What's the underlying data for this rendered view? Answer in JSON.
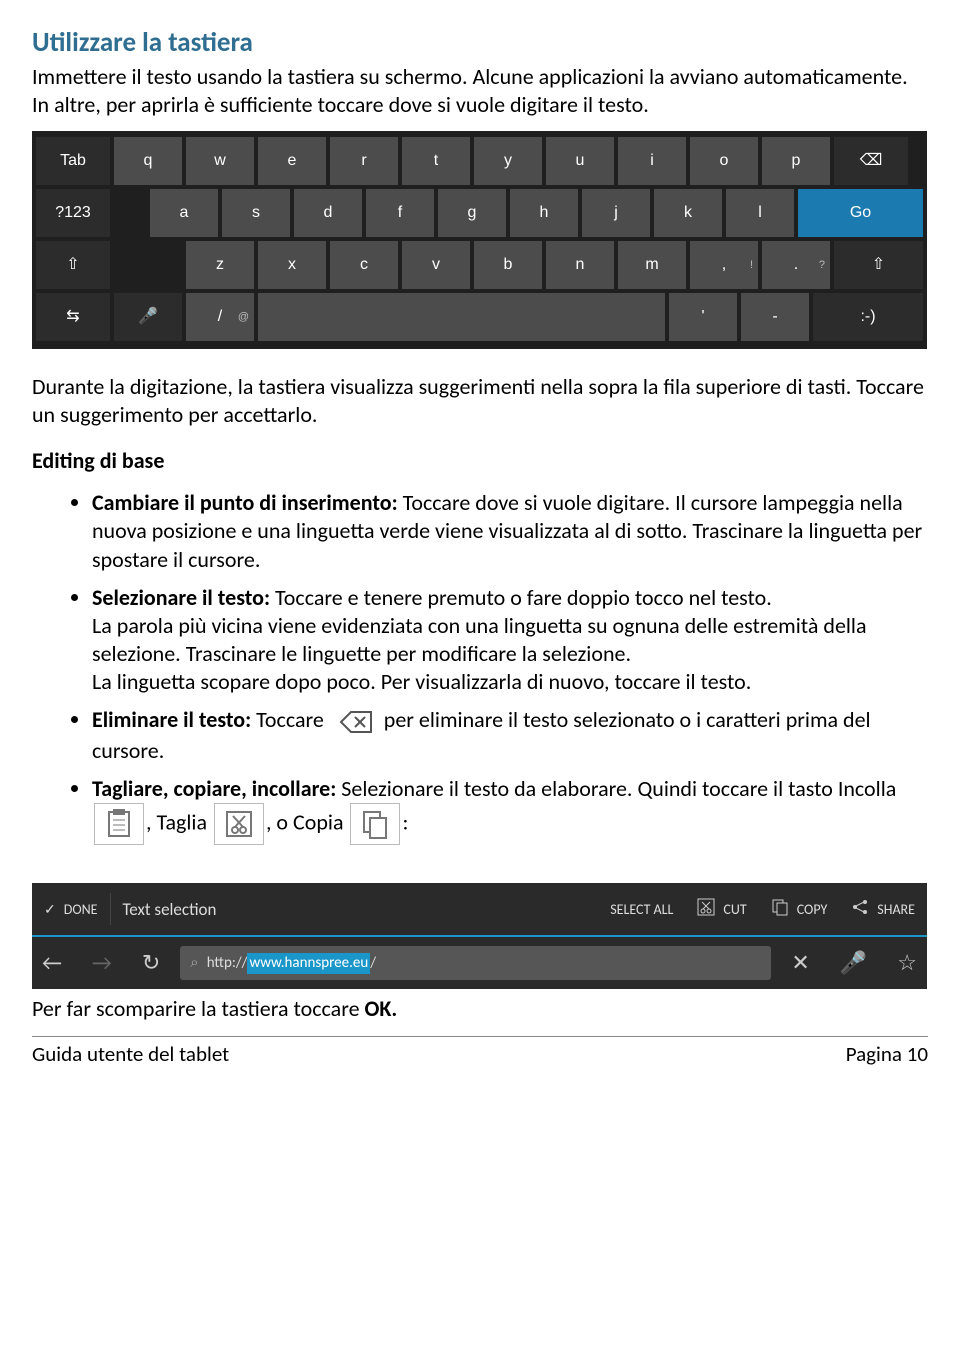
{
  "title": "Utilizzare la tastiera",
  "intro": "Immettere il testo usando la tastiera su schermo. Alcune applicazioni la avviano automaticamente. In altre, per aprirla è sufficiente toccare dove si vuole digitare il testo.",
  "keyboard": {
    "row1": [
      "Tab",
      "q",
      "w",
      "e",
      "r",
      "t",
      "y",
      "u",
      "i",
      "o",
      "p",
      "⌫"
    ],
    "row2": [
      "?123",
      "a",
      "s",
      "d",
      "f",
      "g",
      "h",
      "j",
      "k",
      "l",
      "Go"
    ],
    "row3": [
      "⇧",
      "z",
      "x",
      "c",
      "v",
      "b",
      "n",
      "m",
      ",",
      ".",
      "⇧"
    ],
    "row4": [
      "⇆",
      "🎤",
      "/",
      "",
      " ' ",
      "-",
      ":-)"
    ]
  },
  "para_after_kbd": "Durante la digitazione, la tastiera visualizza suggerimenti nella sopra la fila superiore di tasti. Toccare un suggerimento per accettarlo.",
  "editing_heading": "Editing di base",
  "b1_lead": "Cambiare il punto di inserimento:",
  "b1_rest": " Toccare dove si vuole digitare. Il cursore lampeggia nella nuova posizione e una linguetta verde viene visualizzata al di sotto. Trascinare la linguetta per spostare il cursore.",
  "b2_lead": "Selezionare il testo:",
  "b2_rest": " Toccare e tenere premuto o fare doppio tocco nel testo.",
  "b2_p2": "La parola più vicina viene evidenziata con una linguetta su ognuna delle estremità della selezione. Trascinare le linguette per modificare la selezione.",
  "b2_p3": "La linguetta scopare dopo poco. Per visualizzarla di nuovo, toccare il testo.",
  "b3_lead": "Eliminare il testo:",
  "b3_a": " Toccare ",
  "b3_b": " per eliminare il testo selezionato o i caratteri prima del cursore.",
  "b4_lead": "Tagliare, copiare, incollare:",
  "b4_a": " Selezionare il testo da elaborare. Quindi toccare il tasto Incolla ",
  "b4_b": ", Taglia ",
  "b4_c": ", o Copia ",
  "b4_d": ":",
  "toolbar": {
    "done": "DONE",
    "title": "Text selection",
    "selectall": "SELECT ALL",
    "cut": "CUT",
    "copy": "COPY",
    "share": "SHARE",
    "url_pre": "http://",
    "url_sel": "www.hannspree.eu",
    "url_post": "/"
  },
  "closing": "Per far scomparire la tastiera toccare ",
  "closing_bold": "OK.",
  "footer_left": "Guida utente del tablet",
  "footer_right": "Pagina 10"
}
